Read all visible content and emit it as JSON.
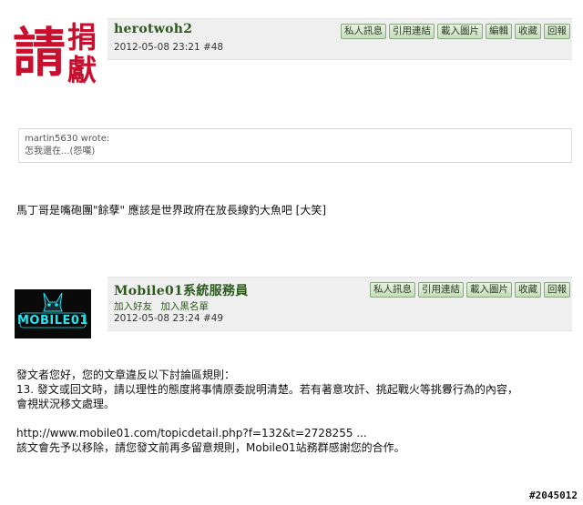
{
  "post1": {
    "avatar_chars": [
      "請",
      "捐",
      "獻"
    ],
    "username": "herotwoh2",
    "meta": "2012-05-08 23:21 #48",
    "actions": [
      "私人訊息",
      "引用連結",
      "載入圖片",
      "編輯",
      "收藏",
      "回報"
    ],
    "quote": {
      "author_line": "martin5630 wrote:",
      "text": "怎我還在...(怨嘆)"
    },
    "body": "馬丁哥是嘴砲團\"餘孽\" 應該是世界政府在放長線釣大魚吧 [大笑]"
  },
  "post2": {
    "avatar_text": "MOBILE01",
    "username": "Mobile01系統服務員",
    "links": [
      "加入好友",
      "加入黑名單"
    ],
    "meta": "2012-05-08 23:24 #49",
    "actions": [
      "私人訊息",
      "引用連結",
      "載入圖片",
      "收藏",
      "回報"
    ],
    "body_lines": [
      "發文者您好，您的文章違反以下討論區規則：",
      "13. 發文或回文時，請以理性的態度將事情原委說明清楚。若有著意攻訐、挑起戰火等挑釁行為的內容，",
      "會視狀況移文處理。",
      "",
      "http://www.mobile01.com/topicdetail.php?f=132&t=2728255 ...",
      "該文會先予以移除，請您發文前再多留意規則，Mobile01站務群感謝您的合作。"
    ]
  },
  "watermark": "#2045012",
  "colors": {
    "username": "#2c5a1d",
    "avatar_red": "#c8102e",
    "avatar_cyan": "#27e3f0",
    "header_bg": "#efefef"
  }
}
